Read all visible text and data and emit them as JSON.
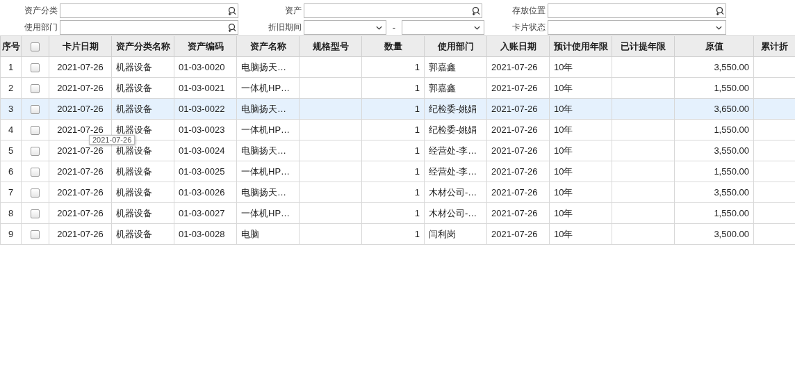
{
  "filters": [
    {
      "label": "资产分类",
      "kind": "lookup"
    },
    {
      "label": "资产",
      "kind": "lookup"
    },
    {
      "label": "存放位置",
      "kind": "lookup"
    },
    {
      "label": "使用部门",
      "kind": "lookup"
    },
    {
      "label": "折旧期间",
      "kind": "range",
      "separator": "-"
    },
    {
      "label": "卡片状态",
      "kind": "select"
    }
  ],
  "table": {
    "select_all": {
      "checked": false
    },
    "columns": [
      {
        "label": "序号"
      },
      {
        "label": "卡片日期"
      },
      {
        "label": "资产分类名称"
      },
      {
        "label": "资产编码"
      },
      {
        "label": "资产名称"
      },
      {
        "label": "规格型号"
      },
      {
        "label": "数量"
      },
      {
        "label": "使用部门"
      },
      {
        "label": "入账日期"
      },
      {
        "label": "预计使用年限"
      },
      {
        "label": "已计提年限"
      },
      {
        "label": "原值"
      },
      {
        "label": "累计折"
      }
    ],
    "rows": [
      {
        "selected": false,
        "checked": false,
        "cells": [
          "1",
          "2021-07-26",
          "机器设备",
          "01-03-0020",
          "电脑扬天…",
          "",
          "1",
          "郭嘉鑫",
          "2021-07-26",
          "10年",
          "",
          "3,550.00",
          ""
        ]
      },
      {
        "selected": false,
        "checked": false,
        "cells": [
          "2",
          "2021-07-26",
          "机器设备",
          "01-03-0021",
          "一体机HP…",
          "",
          "1",
          "郭嘉鑫",
          "2021-07-26",
          "10年",
          "",
          "1,550.00",
          ""
        ]
      },
      {
        "selected": true,
        "checked": false,
        "cells": [
          "3",
          "2021-07-26",
          "机器设备",
          "01-03-0022",
          "电脑扬天…",
          "",
          "1",
          "纪检委-姚娟",
          "2021-07-26",
          "10年",
          "",
          "3,650.00",
          ""
        ]
      },
      {
        "selected": false,
        "checked": false,
        "cells": [
          "4",
          "2021-07-26",
          "机器设备",
          "01-03-0023",
          "一体机HP…",
          "",
          "1",
          "纪检委-姚娟",
          "2021-07-26",
          "10年",
          "",
          "1,550.00",
          ""
        ]
      },
      {
        "selected": false,
        "checked": false,
        "cells": [
          "5",
          "2021-07-26",
          "机器设备",
          "01-03-0024",
          "电脑扬天…",
          "",
          "1",
          "经营处-李…",
          "2021-07-26",
          "10年",
          "",
          "3,550.00",
          ""
        ]
      },
      {
        "selected": false,
        "checked": false,
        "cells": [
          "6",
          "2021-07-26",
          "机器设备",
          "01-03-0025",
          "一体机HP…",
          "",
          "1",
          "经营处-李…",
          "2021-07-26",
          "10年",
          "",
          "1,550.00",
          ""
        ]
      },
      {
        "selected": false,
        "checked": false,
        "cells": [
          "7",
          "2021-07-26",
          "机器设备",
          "01-03-0026",
          "电脑扬天…",
          "",
          "1",
          "木材公司-…",
          "2021-07-26",
          "10年",
          "",
          "3,550.00",
          ""
        ]
      },
      {
        "selected": false,
        "checked": false,
        "cells": [
          "8",
          "2021-07-26",
          "机器设备",
          "01-03-0027",
          "一体机HP…",
          "",
          "1",
          "木材公司-…",
          "2021-07-26",
          "10年",
          "",
          "1,550.00",
          ""
        ]
      },
      {
        "selected": false,
        "checked": false,
        "cells": [
          "9",
          "2021-07-26",
          "机器设备",
          "01-03-0028",
          "电脑",
          "",
          "1",
          "闫利岗",
          "2021-07-26",
          "10年",
          "",
          "3,500.00",
          ""
        ]
      }
    ]
  },
  "tooltip": {
    "text": "2021-07-26"
  }
}
